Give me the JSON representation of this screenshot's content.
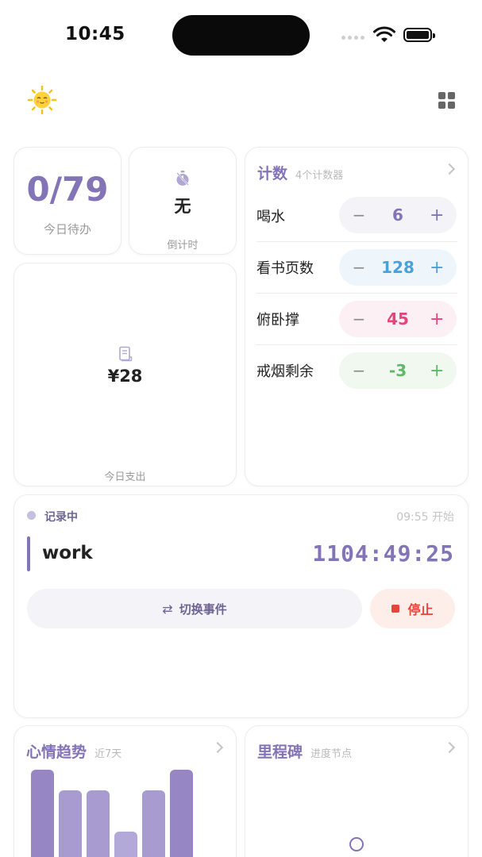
{
  "status_bar": {
    "time": "10:45"
  },
  "header": {
    "weather_icon": "sun-face-icon",
    "menu_icon": "grid-icon"
  },
  "todo": {
    "value": "0/79",
    "label": "今日待办"
  },
  "countdown": {
    "icon": "timer-icon",
    "value": "无",
    "label": "倒计时"
  },
  "expense": {
    "icon": "receipt-icon",
    "value": "¥28",
    "label": "今日支出"
  },
  "counters": {
    "title": "计数",
    "subtitle": "4个计数器",
    "minus": "−",
    "plus": "+",
    "items": [
      {
        "name": "喝水",
        "value": "6",
        "color": "#8274b6",
        "bg": "#f4f3f8"
      },
      {
        "name": "看书页数",
        "value": "128",
        "color": "#4aa3d8",
        "bg": "#eef6fc"
      },
      {
        "name": "俯卧撑",
        "value": "45",
        "color": "#e4457c",
        "bg": "#fdf0f4"
      },
      {
        "name": "戒烟剩余",
        "value": "-3",
        "color": "#5fb86a",
        "bg": "#f0f8f0"
      }
    ]
  },
  "timer": {
    "status": "记录中",
    "start": "09:55 开始",
    "event": "work",
    "elapsed": "1104:49:25",
    "switch_label": "切换事件",
    "stop_label": "停止"
  },
  "mood": {
    "title": "心情趋势",
    "subtitle": "近7天",
    "values": [
      5,
      4,
      4,
      2,
      4,
      5
    ]
  },
  "milestone": {
    "title": "里程碑",
    "subtitle": "进度节点"
  }
}
